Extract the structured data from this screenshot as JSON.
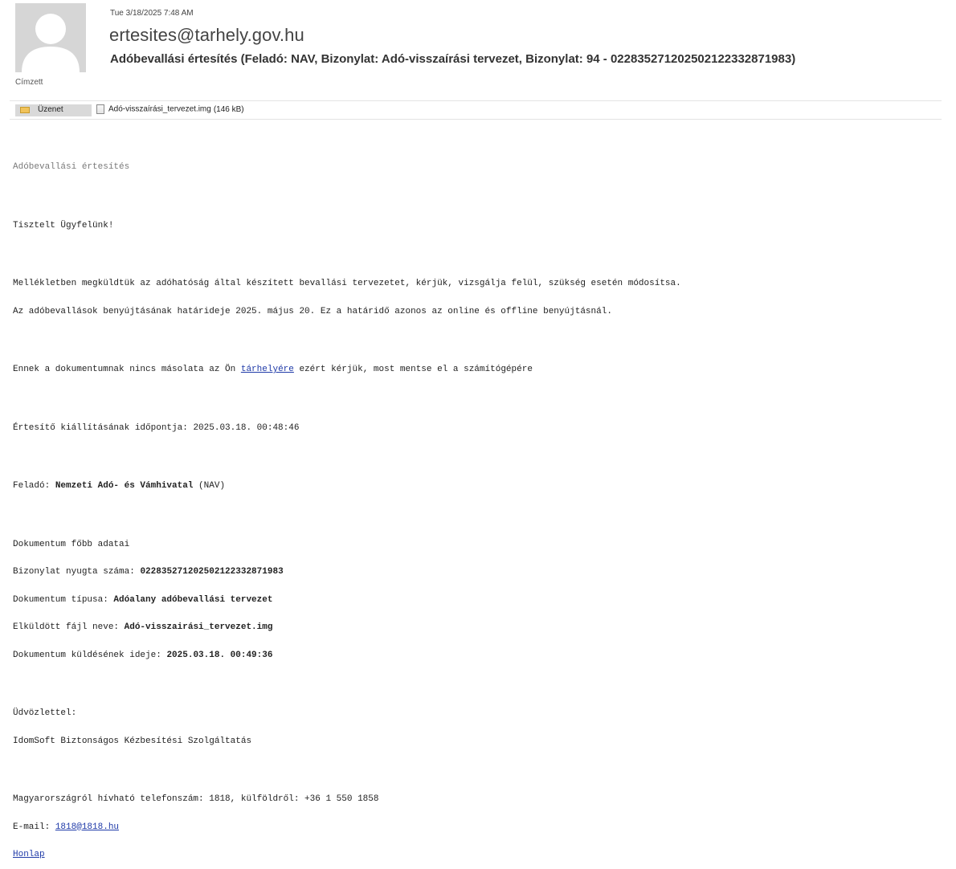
{
  "email": {
    "date": "Tue 3/18/2025 7:48 AM",
    "sender": "ertesites@tarhely.gov.hu",
    "subject": "Adóbevallási értesítés (Feladó: NAV, Bizonylat: Adó-visszaírási tervezet, Bizonylat: 94 - 022835271202502122332871983)",
    "recipient_label": "Címzett"
  },
  "attachments": {
    "message_tab": "Üzenet",
    "file_name": "Adó-visszaírási_tervezet.img",
    "file_size": "(146 kB)"
  },
  "body": {
    "heading": "Adóbevallási értesítés",
    "greeting": "Tisztelt Ügyfelünk!",
    "para1_line1": "Mellékletben megküldtük az adóhatóság által készített bevallási tervezetet, kérjük, vizsgálja felül, szükség esetén módosítsa.",
    "para1_line2": "Az adóbevallások benyújtásának határideje 2025. május 20. Ez a határidő azonos az online és offline benyújtásnál.",
    "para2_before": "Ennek a dokumentumnak nincs másolata az Ön ",
    "para2_link": "tárhelyére",
    "para2_after": " ezért kérjük, most mentse el a számítógépére",
    "issued_label": "Értesítő kiállításának időpontja: ",
    "issued_value": "2025.03.18. 00:48:46",
    "sender_label": "Feladó: ",
    "sender_name": "Nemzeti Adó- és Vámhivatal",
    "sender_abbr": " (NAV)",
    "doc_title": "Dokumentum főbb adatai",
    "receipt_label": "Bizonylat nyugta száma: ",
    "receipt_value": "022835271202502122332871983",
    "type_label": "Dokumentum típusa: ",
    "type_value": "Adóalany adóbevallási tervezet",
    "file_label": "Elküldött fájl neve: ",
    "file_value": "Adó-visszairási_tervezet.img",
    "sent_label": "Dokumentum küldésének ideje: ",
    "sent_value": "2025.03.18. 00:49:36",
    "regards": "Üdvözlettel:",
    "signature": "IdomSoft Biztonságos Kézbesítési Szolgáltatás",
    "phone": "Magyarországról hívható telefonszám: 1818, külföldről: +36 1 550 1858",
    "email_label": "E-mail: ",
    "email_link": "1818@1818.hu",
    "homepage_link": "Honlap"
  },
  "colors": {
    "link": "#1f3aa8",
    "tab_bg": "#d9d9d9",
    "envelope": "#f1c35a"
  }
}
